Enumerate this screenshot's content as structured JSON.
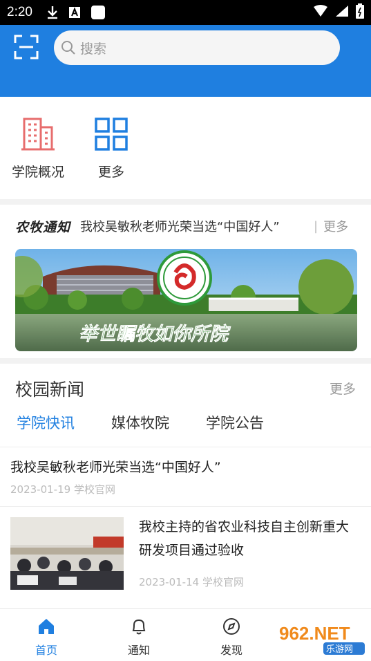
{
  "status_bar": {
    "time": "2:20"
  },
  "search": {
    "placeholder": "搜索"
  },
  "quick_menu": [
    {
      "label": "学院概况",
      "icon": "building-icon"
    },
    {
      "label": "更多",
      "icon": "grid-icon"
    }
  ],
  "notice": {
    "logo_text": "农牧通知",
    "text": "我校吴敏秋老师光荣当选“中国好人”",
    "more": "更多"
  },
  "banner": {
    "slogan": "举世瞩牧如你所院",
    "emblem_colors": {
      "ring": "#2e9a3a",
      "center": "#d42a2a"
    }
  },
  "news": {
    "title": "校园新闻",
    "more": "更多",
    "tabs": [
      "学院快讯",
      "媒体牧院",
      "学院公告"
    ],
    "active_tab": 0,
    "items": [
      {
        "title": "我校吴敏秋老师光荣当选“中国好人”",
        "meta": "2023-01-19 学校官网"
      },
      {
        "title": "我校主持的省农业科技自主创新重大研发项目通过验收",
        "meta": "2023-01-14 学校官网",
        "has_image": true
      }
    ]
  },
  "bottom_nav": [
    {
      "label": "首页",
      "icon": "home-icon",
      "active": true
    },
    {
      "label": "通知",
      "icon": "bell-icon",
      "active": false
    },
    {
      "label": "发现",
      "icon": "compass-icon",
      "active": false
    }
  ],
  "watermark": {
    "text_top": "962.NET",
    "text_bottom": "乐游网"
  },
  "colors": {
    "primary": "#1f7fe0",
    "quick_icon_red": "#e76d6d",
    "quick_icon_blue": "#1f7fe0"
  }
}
